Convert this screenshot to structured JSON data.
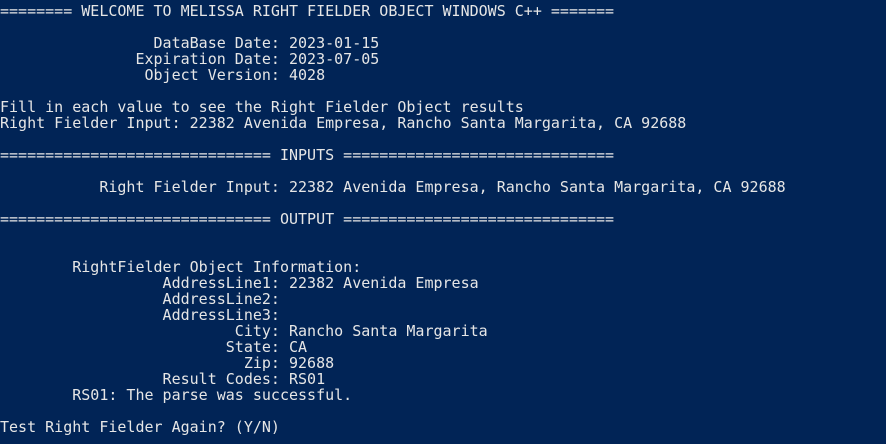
{
  "console": {
    "lines": [
      "======== WELCOME TO MELISSA RIGHT FIELDER OBJECT WINDOWS C++ =======",
      "",
      "                 DataBase Date: 2023-01-15",
      "               Expiration Date: 2023-07-05",
      "                Object Version: 4028",
      "",
      "Fill in each value to see the Right Fielder Object results",
      "Right Fielder Input: 22382 Avenida Empresa, Rancho Santa Margarita, CA 92688",
      "",
      "============================== INPUTS ==============================",
      "",
      "           Right Fielder Input: 22382 Avenida Empresa, Rancho Santa Margarita, CA 92688",
      "",
      "============================== OUTPUT ==============================",
      "",
      "",
      "        RightFielder Object Information:",
      "                  AddressLine1: 22382 Avenida Empresa",
      "                  AddressLine2:",
      "                  AddressLine3:",
      "                          City: Rancho Santa Margarita",
      "                         State: CA",
      "                           Zip: 92688",
      "                  Result Codes: RS01",
      "        RS01: The parse was successful.",
      "",
      "Test Right Fielder Again? (Y/N)"
    ]
  }
}
